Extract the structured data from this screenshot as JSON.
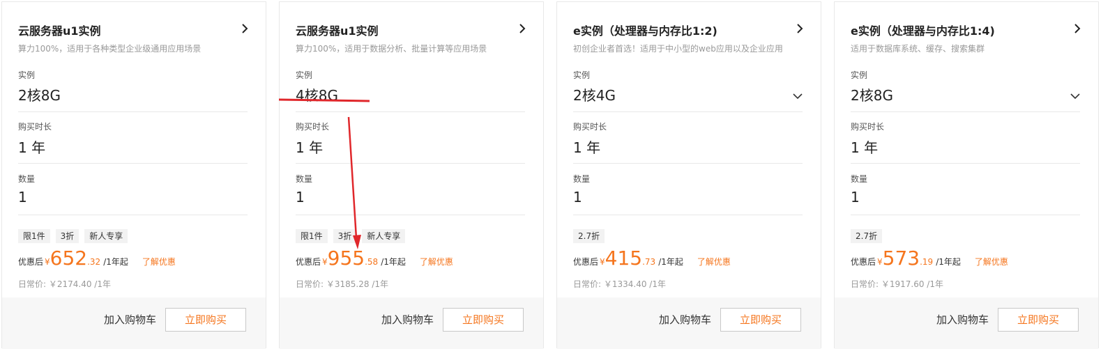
{
  "cards": [
    {
      "title": "云服务器u1实例",
      "desc": "算力100%，适用于各种类型企业级通用应用场景",
      "instance_label": "实例",
      "instance_value": "2核8G",
      "duration_label": "购买时长",
      "duration_value": "1 年",
      "qty_label": "数量",
      "qty_value": "1",
      "tags": [
        "限1件",
        "3折",
        "新人专享"
      ],
      "price_prefix": "优惠后",
      "currency": "¥",
      "price_int": "652",
      "price_dec": ".32",
      "price_unit": "/1年起",
      "promo_link": "了解优惠",
      "regular_price": "日常价: ￥2174.40 /1年",
      "cart_label": "加入购物车",
      "buy_label": "立即购买",
      "has_dropdown": false
    },
    {
      "title": "云服务器u1实例",
      "desc": "算力100%，适用于数据分析、批量计算等应用场景",
      "instance_label": "实例",
      "instance_value": "4核8G",
      "duration_label": "购买时长",
      "duration_value": "1 年",
      "qty_label": "数量",
      "qty_value": "1",
      "tags": [
        "限1件",
        "3折",
        "新人专享"
      ],
      "price_prefix": "优惠后",
      "currency": "¥",
      "price_int": "955",
      "price_dec": ".58",
      "price_unit": "/1年起",
      "promo_link": "了解优惠",
      "regular_price": "日常价: ￥3185.28 /1年",
      "cart_label": "加入购物车",
      "buy_label": "立即购买",
      "has_dropdown": false
    },
    {
      "title": "e实例（处理器与内存比1:2)",
      "desc": "初创企业者首选！适用于中小型的web应用以及企业应用",
      "instance_label": "实例",
      "instance_value": "2核4G",
      "duration_label": "购买时长",
      "duration_value": "1 年",
      "qty_label": "数量",
      "qty_value": "1",
      "tags": [
        "2.7折"
      ],
      "price_prefix": "优惠后",
      "currency": "¥",
      "price_int": "415",
      "price_dec": ".73",
      "price_unit": "/1年起",
      "promo_link": "了解优惠",
      "regular_price": "日常价: ￥1334.40 /1年",
      "cart_label": "加入购物车",
      "buy_label": "立即购买",
      "has_dropdown": true
    },
    {
      "title": "e实例（处理器与内存比1:4)",
      "desc": "适用于数据库系统、缓存、搜索集群",
      "instance_label": "实例",
      "instance_value": "2核8G",
      "duration_label": "购买时长",
      "duration_value": "1 年",
      "qty_label": "数量",
      "qty_value": "1",
      "tags": [
        "2.7折"
      ],
      "price_prefix": "优惠后",
      "currency": "¥",
      "price_int": "573",
      "price_dec": ".19",
      "price_unit": "/1年起",
      "promo_link": "了解优惠",
      "regular_price": "日常价: ￥1917.60 /1年",
      "cart_label": "加入购物车",
      "buy_label": "立即购买",
      "has_dropdown": true
    }
  ],
  "colors": {
    "accent": "#f5751d",
    "annotation": "#e0272b",
    "footer_bg": "#f7f7f7"
  },
  "icons": {
    "card_link": "chevron-right-icon",
    "dropdown": "chevron-down-icon"
  }
}
